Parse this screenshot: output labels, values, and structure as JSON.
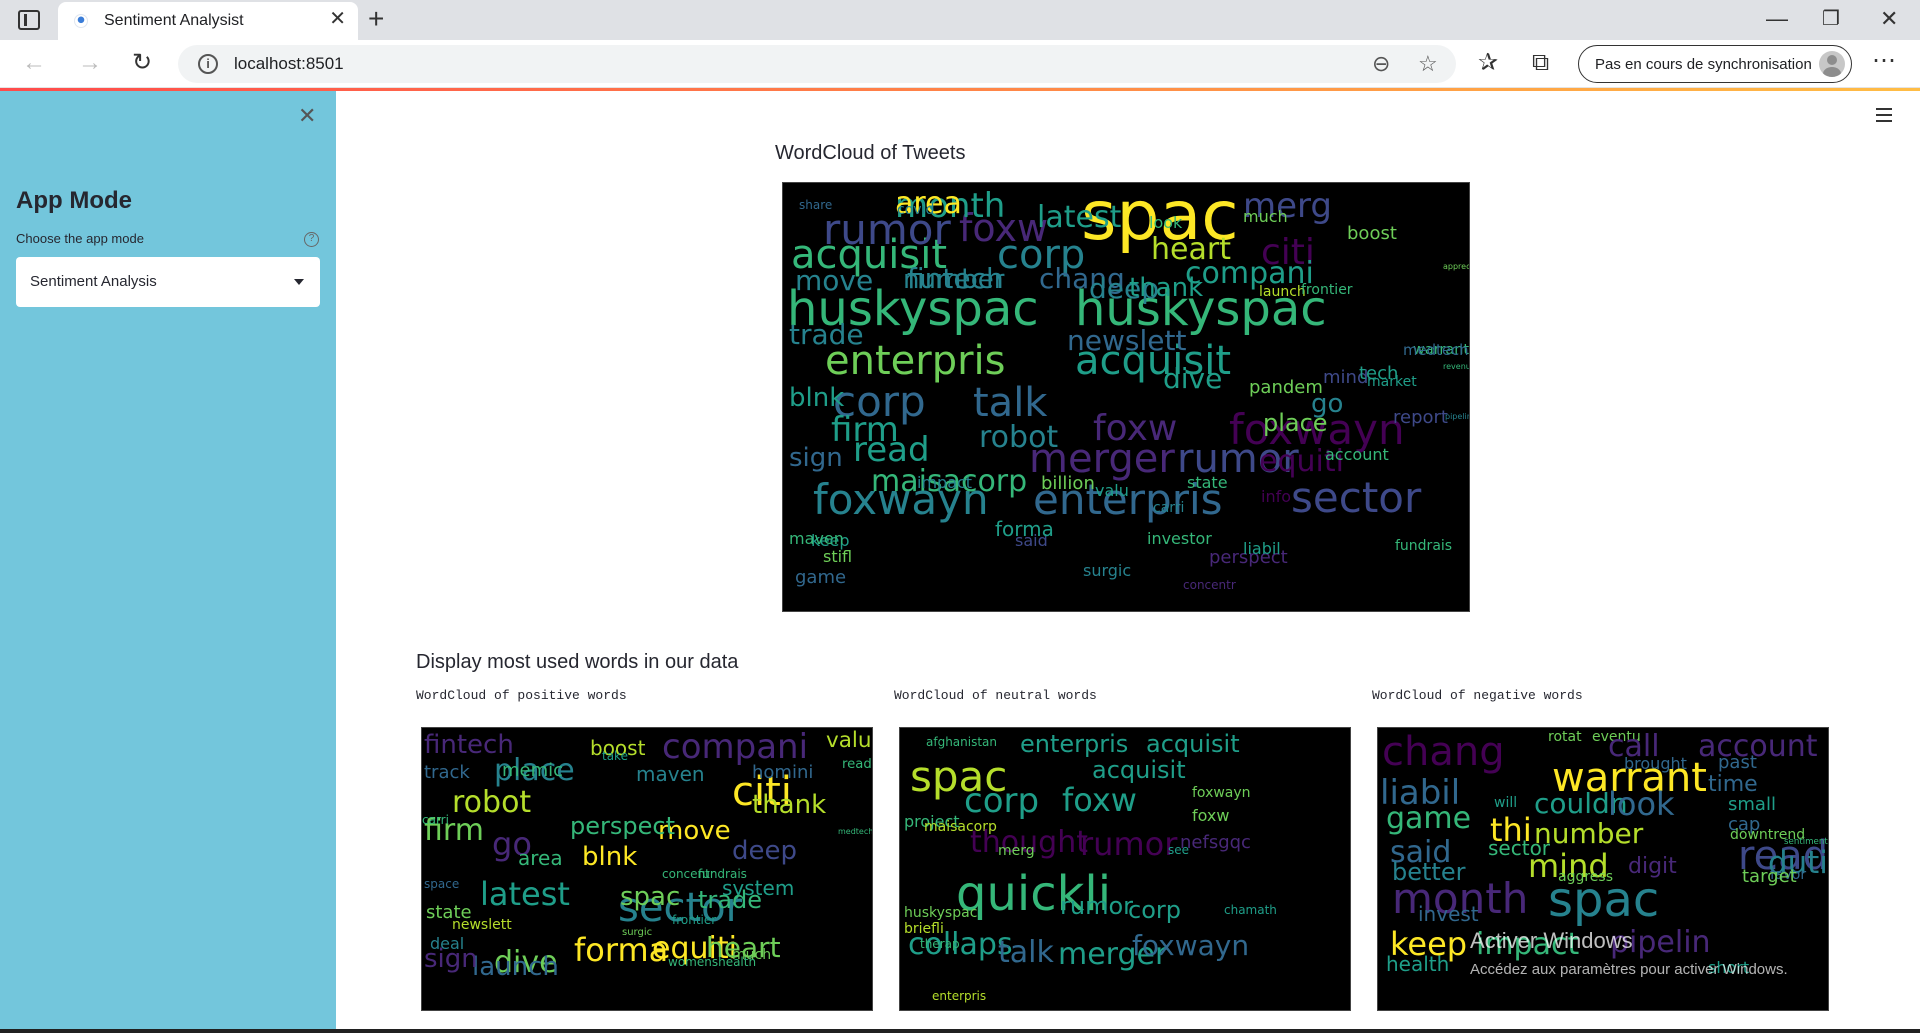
{
  "browser": {
    "tab_title": "Sentiment Analysist",
    "url": "localhost:8501",
    "sync_label": "Pas en cours de synchronisation"
  },
  "sidebar": {
    "title": "App Mode",
    "select_label": "Choose the app mode",
    "select_value": "Sentiment Analysis"
  },
  "main": {
    "wordcloud_heading": "WordCloud of Tweets",
    "section_heading": "Display most used words in our data",
    "captions": {
      "positive": "WordCloud of positive words",
      "neutral": "WordCloud of neutral words",
      "negative": "WordCloud of negative words"
    }
  },
  "watermark": {
    "title": "Activer Windows",
    "subtitle": "Accédez aux paramètres pour activer Windows."
  },
  "wordclouds": {
    "tweets": [
      "spac",
      "huskyspac",
      "huskyspac",
      "acquisit",
      "corp",
      "enterpris",
      "acquisit",
      "rumor",
      "foxw",
      "merg",
      "citi",
      "heart",
      "compani",
      "number",
      "move",
      "fintech",
      "chang",
      "deep",
      "thank",
      "launch",
      "frontier",
      "trade",
      "newslett",
      "corp",
      "talk",
      "firm",
      "foxw",
      "foxwayn",
      "read",
      "robot",
      "merger",
      "rumor",
      "warrant",
      "maisacorp",
      "sign",
      "blnk",
      "foxwayn",
      "enterpris",
      "sector",
      "equiti",
      "month",
      "area",
      "latest",
      "look",
      "boost",
      "place",
      "dive",
      "go",
      "mtac",
      "said",
      "billion",
      "investor",
      "forma",
      "perspect",
      "surgic",
      "mind",
      "info",
      "fundrais",
      "pandem",
      "tech",
      "market",
      "report",
      "state",
      "liabil",
      "carri",
      "game",
      "stifl",
      "keep",
      "maven",
      "impact",
      "valu",
      "concentr",
      "medtech",
      "account",
      "covid",
      "share",
      "much",
      "appreci",
      "revenu",
      "pipelin"
    ],
    "positive": [
      "fintech",
      "compani",
      "valu",
      "place",
      "citi",
      "boost",
      "track",
      "memic",
      "maven",
      "homini",
      "robot",
      "thank",
      "read",
      "firm",
      "move",
      "medtech",
      "go",
      "perspect",
      "blnk",
      "deep",
      "latest",
      "area",
      "sector",
      "spac",
      "system",
      "trade",
      "dive",
      "surgic",
      "forma",
      "launch",
      "equiti",
      "heart",
      "sign",
      "newslett",
      "space",
      "deal",
      "state",
      "carri",
      "take",
      "fundrais",
      "much",
      "concentr",
      "womenshealth",
      "frontier"
    ],
    "neutral": [
      "afghanistan",
      "enterpris",
      "acquisit",
      "spac",
      "acquisit",
      "corp",
      "foxw",
      "foxwayn",
      "project",
      "maisacorp",
      "thought",
      "rumor",
      "foxw",
      "nefsgqc",
      "merg",
      "quickli",
      "huskyspac",
      "briefli",
      "collaps",
      "merger",
      "rumor",
      "corp",
      "talk",
      "foxwayn",
      "enterpris",
      "chamath",
      "see",
      "therap"
    ],
    "negative": [
      "chang",
      "rotat",
      "eventu",
      "call",
      "account",
      "brought",
      "past",
      "liabil",
      "warrant",
      "time",
      "game",
      "couldn",
      "look",
      "small",
      "will",
      "cap",
      "thi",
      "number",
      "said",
      "sector",
      "read",
      "better",
      "mind",
      "digit",
      "aggress",
      "month",
      "spac",
      "duti",
      "invest",
      "keep",
      "impact",
      "pipelin",
      "health",
      "short",
      "downtrend",
      "sentiment",
      "favor",
      "target"
    ]
  }
}
